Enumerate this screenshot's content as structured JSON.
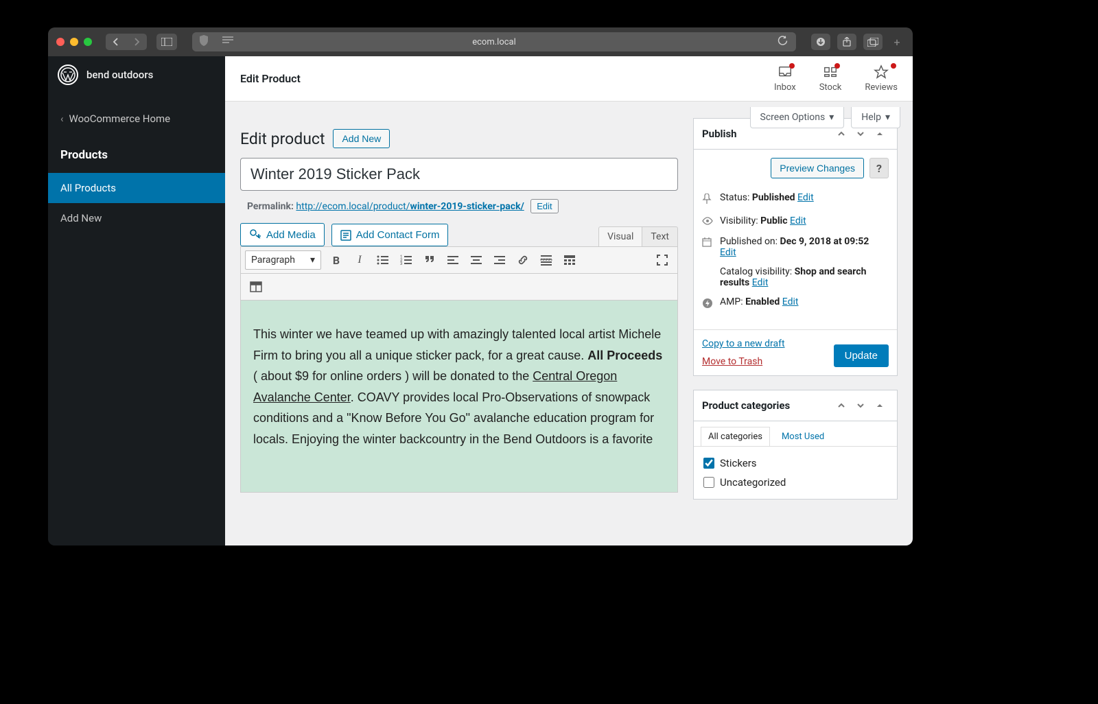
{
  "browser": {
    "url": "ecom.local"
  },
  "site_name": "bend outdoors",
  "back_link": "WooCommerce Home",
  "sidebar": {
    "section": "Products",
    "items": [
      "All Products",
      "Add New"
    ]
  },
  "header": {
    "title": "Edit Product",
    "tabs": [
      "Inbox",
      "Stock",
      "Reviews"
    ]
  },
  "screen_options": "Screen Options",
  "help": "Help",
  "page_title": "Edit product",
  "add_new": "Add New",
  "product_title": "Winter 2019 Sticker Pack",
  "permalink": {
    "label": "Permalink:",
    "base": "http://ecom.local/product/",
    "slug": "winter-2019-sticker-pack/",
    "edit": "Edit"
  },
  "editor": {
    "add_media": "Add Media",
    "add_contact": "Add Contact Form",
    "tab_visual": "Visual",
    "tab_text": "Text",
    "format": "Paragraph",
    "body_1": "This winter we have teamed up with amazingly talented local artist Michele Firm to bring you all a unique sticker pack, for a great cause. ",
    "body_bold": "All Proceeds",
    "body_2": " ( about $9 for online orders ) will be donated to the ",
    "body_link": "Central Oregon Avalanche Center",
    "body_3": ". COAVY provides local Pro-Observations of snowpack conditions and a \"Know Before You Go\" avalanche education program for locals. Enjoying the winter backcountry in the Bend Outdoors is a favorite"
  },
  "publish": {
    "title": "Publish",
    "preview": "Preview Changes",
    "status_label": "Status:",
    "status_value": "Published",
    "visibility_label": "Visibility:",
    "visibility_value": "Public",
    "published_label": "Published on:",
    "published_value": "Dec 9, 2018 at 09:52",
    "catalog_label": "Catalog visibility:",
    "catalog_value": "Shop and search results",
    "amp_label": "AMP:",
    "amp_value": "Enabled",
    "edit": "Edit",
    "copy": "Copy to a new draft",
    "trash": "Move to Trash",
    "update": "Update"
  },
  "categories": {
    "title": "Product categories",
    "tab_all": "All categories",
    "tab_most": "Most Used",
    "items": [
      {
        "label": "Stickers",
        "checked": true
      },
      {
        "label": "Uncategorized",
        "checked": false
      }
    ]
  }
}
